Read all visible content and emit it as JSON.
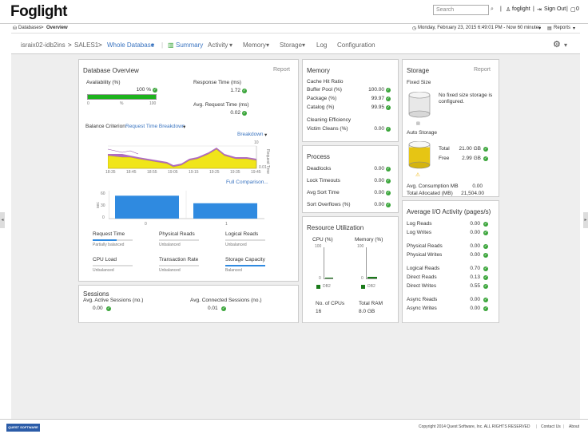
{
  "app": {
    "logo": "Foglight",
    "search_placeholder": "Search",
    "user": "foglight",
    "sign_out": "Sign Out",
    "window_icon_count": "0"
  },
  "breadcrumb": {
    "root": "Databases",
    "sep": ">",
    "current": "Overview"
  },
  "timerange": {
    "label": "Monday, February 23, 2015 6:49:01 PM - Now 60 minutes",
    "reports": "Reports"
  },
  "nav": {
    "instance": "israix02-idb2ins",
    "sep1": ">",
    "db": "SALES1",
    "sep2": ">",
    "view": "Whole Database",
    "summary": "Summary",
    "activity": "Activity",
    "memory": "Memory",
    "storage": "Storage",
    "log": "Log",
    "configuration": "Configuration"
  },
  "db_overview": {
    "title": "Database Overview",
    "report": "Report",
    "availability_label": "Availability (%)",
    "availability_value": "100 %",
    "availability_fraction": 1.0,
    "scale": [
      "0",
      "%",
      "100"
    ],
    "response_time_label": "Response Time (ms)",
    "response_time_value": "1.72",
    "avg_request_label": "Avg. Request Time (ms)",
    "avg_request_value": "0.02",
    "balance_label": "Balance Criterion:",
    "balance_value": "Request Time Breakdown",
    "breakdown": "Breakdown",
    "full_comparison": "Full Comparison...",
    "ylabel": "Request Time",
    "x_ticks": [
      "18:35",
      "18:45",
      "18:55",
      "19:05",
      "19:15",
      "19:25",
      "19:35",
      "19:45"
    ],
    "y_right_ticks": [
      "10",
      "0.01"
    ],
    "bar_ylabel": "sec",
    "bar_y_ticks": [
      "60",
      "30",
      "0"
    ],
    "bar_x_ticks": [
      "0",
      "1"
    ],
    "bar_values_fraction": [
      0.82,
      0.55
    ],
    "balance_items": [
      {
        "name": "Request Time",
        "status": "Partially balanced"
      },
      {
        "name": "Physical Reads",
        "status": "Unbalanced"
      },
      {
        "name": "Logical Reads",
        "status": "Unbalanced"
      },
      {
        "name": "CPU Load",
        "status": "Unbalanced"
      },
      {
        "name": "Transaction Rate",
        "status": "Unbalanced"
      },
      {
        "name": "Storage Capacity",
        "status": "Balanced"
      }
    ]
  },
  "sessions": {
    "title": "Sessions",
    "active_label": "Avg. Active Sessions (no.)",
    "active_value": "0.00",
    "connected_label": "Avg. Connected Sessions (no.)",
    "connected_value": "0.01"
  },
  "memory": {
    "title": "Memory",
    "cache_hit": "Cache Hit Ratio",
    "rows": [
      {
        "label": "Buffer Pool (%)",
        "value": "100.00"
      },
      {
        "label": "Package (%)",
        "value": "99.97"
      },
      {
        "label": "Catalog (%)",
        "value": "99.95"
      }
    ],
    "cleaning": "Cleaning Efficiency",
    "victim_label": "Victim Cleans (%)",
    "victim_value": "0.00"
  },
  "process": {
    "title": "Process",
    "rows": [
      {
        "label": "Deadlocks",
        "value": "0.00"
      },
      {
        "label": "Lock Timeouts",
        "value": "0.00"
      },
      {
        "label": "Avg Sort Time",
        "value": "0.00"
      },
      {
        "label": "Sort Overflows (%)",
        "value": "0.00"
      }
    ]
  },
  "resource": {
    "title": "Resource Utilization",
    "cpu_label": "CPU (%)",
    "mem_label": "Memory (%)",
    "ticks": [
      "100",
      "0"
    ],
    "legend": "DB2",
    "cpu_fraction": 0.0,
    "mem_fraction": 0.06,
    "cpus_label": "No. of CPUs",
    "cpus_value": "16",
    "ram_label": "Total RAM",
    "ram_value": "8.0 GB"
  },
  "storage": {
    "title": "Storage",
    "report": "Report",
    "fixed_size": "Fixed Size",
    "fixed_msg": "No fixed size storage is configured.",
    "auto_storage": "Auto Storage",
    "total_label": "Total",
    "total_value": "21.00 GB",
    "free_label": "Free",
    "free_value": "2.99 GB",
    "consumption_label": "Avg. Consumption MB",
    "consumption_value": "0.00",
    "allocated_label": "Total Allocated (MB)",
    "allocated_value": "21,504.00",
    "used_fraction": 0.86
  },
  "io": {
    "title": "Average I/O Activity (pages/s)",
    "groups": [
      [
        {
          "label": "Log Reads",
          "value": "0.00"
        },
        {
          "label": "Log Writes",
          "value": "0.00"
        }
      ],
      [
        {
          "label": "Physical Reads",
          "value": "0.00"
        },
        {
          "label": "Physical Writes",
          "value": "0.00"
        }
      ],
      [
        {
          "label": "Logical Reads",
          "value": "0.70"
        },
        {
          "label": "Direct Reads",
          "value": "0.13"
        },
        {
          "label": "Direct Writes",
          "value": "0.55"
        }
      ],
      [
        {
          "label": "Async Reads",
          "value": "0.00"
        },
        {
          "label": "Async Writes",
          "value": "0.00"
        }
      ]
    ]
  },
  "footer": {
    "copyright": "Copyright 2014 Quest Software, Inc. ALL RIGHTS RESERVED",
    "contact": "Contact Us",
    "about": "About",
    "quest": "QUEST SOFTWARE"
  },
  "colors": {
    "ok": "#3aa53a",
    "bar_blue": "#2f8ae0",
    "avail_green": "#1db31d",
    "storage_yellow": "#e6c514",
    "warning": "#f0b400"
  }
}
